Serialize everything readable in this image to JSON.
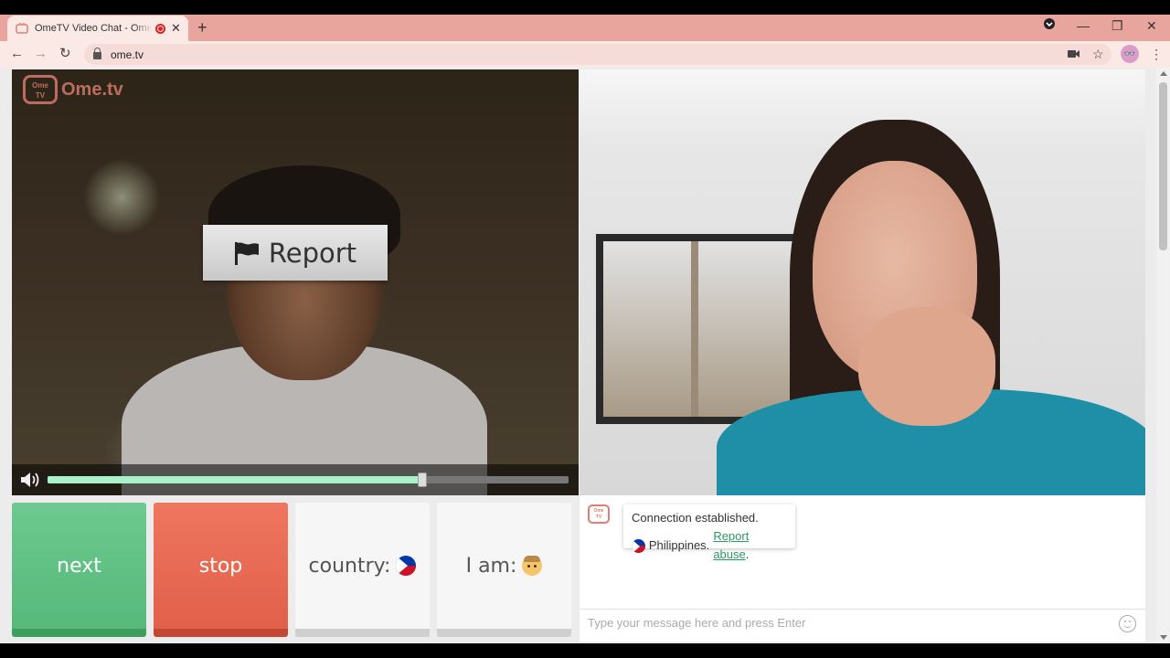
{
  "browser": {
    "tab_title": "OmeTV Video Chat - Omegle",
    "new_tab_icon": "plus-icon",
    "url": "ome.tv",
    "window_controls": {
      "minimize": "—",
      "maximize": "❐",
      "close": "✕"
    },
    "nav": {
      "back": "←",
      "forward": "→",
      "reload": "↻"
    }
  },
  "stranger_video": {
    "watermark": {
      "logo_text_top": "Ome",
      "logo_text_bottom": "TV",
      "brand": "Ome.tv"
    },
    "report_button": {
      "label": "Report",
      "icon": "flag-icon"
    },
    "volume": {
      "level": 0.72,
      "icon": "speaker-icon"
    }
  },
  "controls": {
    "next_label": "next",
    "stop_label": "stop",
    "country_label": "country:",
    "country_flag": "Philippines",
    "gender_label": "I am:",
    "gender_icon": "male-face-icon"
  },
  "chat": {
    "system_message": {
      "line1": "Connection established.",
      "country": "Philippines.",
      "link_text": "Report abuse",
      "trailing": "."
    },
    "input_placeholder": "Type your message here and press Enter",
    "emoji_icon": "smiley-icon"
  },
  "colors": {
    "next": "#5fc084",
    "stop": "#e8694f",
    "link": "#2b9a63",
    "brand": "#e07e72",
    "tabstrip": "#e8a59e"
  }
}
